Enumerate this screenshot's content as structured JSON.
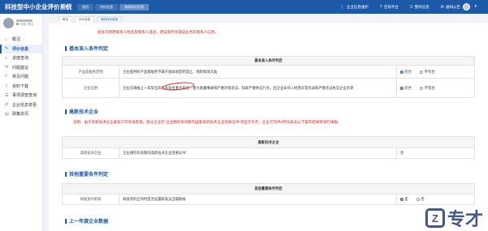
{
  "app": {
    "title": "科技型中小企业评价系统"
  },
  "header": {
    "tabs": [
      "首页",
      "评价信息",
      "修改评价信息"
    ],
    "links": [
      {
        "icon": "user-icon",
        "label": "企业信息维护"
      },
      {
        "icon": "help-icon",
        "label": "咨询平台"
      },
      {
        "icon": "exit-icon",
        "label": "整改信息"
      },
      {
        "icon": "notice-icon",
        "label": "通知公告"
      }
    ]
  },
  "breadcrumbs": [
    "概览",
    "评价信息",
    "修改评价信息"
  ],
  "sidebar": {
    "status": "在线",
    "status2": "退出",
    "items": [
      {
        "label": "概况",
        "icon": "home-icon"
      },
      {
        "label": "评价信息",
        "icon": "edit-icon"
      },
      {
        "label": "进度查询",
        "icon": "search-icon"
      },
      {
        "label": "问题建议",
        "icon": "chat-icon"
      },
      {
        "label": "常见问题",
        "icon": "question-icon"
      },
      {
        "label": "资料下载",
        "icon": "download-icon"
      },
      {
        "label": "事项调查查询",
        "icon": "list-icon"
      },
      {
        "label": "企业信息变更",
        "icon": "swap-icon"
      },
      {
        "label": "政策资讯",
        "icon": "news-icon"
      }
    ]
  },
  "main": {
    "top_warning": "此处可修改联系人姓名及联系人电话，建议留存办理该业务的联系人信息。",
    "sections": {
      "basic": {
        "title": "基本准入条件判定",
        "table_title": "基本准入条件判定",
        "rows": [
          {
            "label": "产品及服务范围",
            "content": "企业提供的产品和服务不属于国家规定的禁止、限制和淘汰类",
            "yes": "符合",
            "no": "不符合"
          },
          {
            "label": "企业信用",
            "content": "企业在填报上一年及当年内未发生重大安全、重大质量事故和严重环境违法、科研严重失信行为，且企业未列入经营异常名录和严重违法失信企业名单",
            "yes": "符合",
            "no": "不符合"
          }
        ]
      },
      "hightech": {
        "title": "高新技术企业",
        "note": "说明：由于高新技术企业备案工作尚未结束，部分企业在“企业拥有有效期内国家高新技术企业资格证书”项显示为否，企业可等待3月份再去以下操作结果即进行填报。",
        "table_title": "高新技术企业",
        "rows": [
          {
            "label": "高新技术企业",
            "content": "企业拥有有效期内高新技术企业资格证书",
            "value": "否"
          }
        ]
      },
      "other": {
        "title": "其他重要条件判定",
        "table_title": "其他重要条件判定",
        "rows": [
          {
            "label": "研发加计扣除",
            "content": "研发项目立项时是否设置研发支出辅助帐",
            "yes": "是",
            "no": "否"
          }
        ]
      },
      "lastyear": {
        "title": "上一年度企业数据"
      }
    }
  },
  "watermark": {
    "text": "专才"
  }
}
